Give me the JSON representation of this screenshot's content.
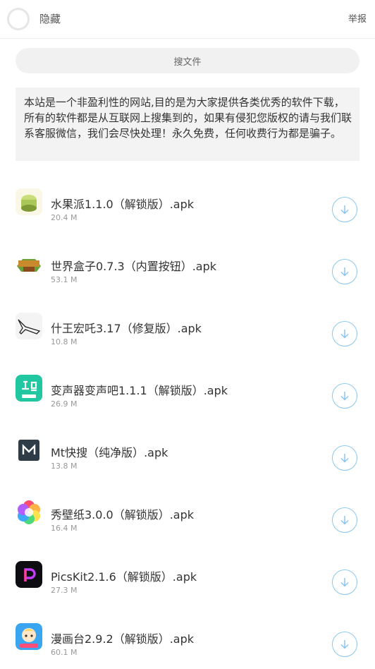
{
  "header": {
    "hide_label": "隐藏",
    "report_label": "举报"
  },
  "search": {
    "placeholder": "搜文件"
  },
  "notice": {
    "text": "本站是一个非盈利性的网站,目的是为大家提供各类优秀的软件下载，所有的软件都是从互联网上搜集到的，如果有侵犯您版权的请与我们联系客服微信，我们会尽快处理！永久免费，任何收费行为都是骗子。"
  },
  "files": [
    {
      "name": "水果派1.1.0（解锁版）.apk",
      "size": "20.4 M",
      "icon": "fruit-pie-app-icon"
    },
    {
      "name": "世界盒子0.7.3（内置按钮）.apk",
      "size": "53.1 M",
      "icon": "worldbox-app-icon"
    },
    {
      "name": "什王宏吒3.17（修复版）.apk",
      "size": "10.8 M",
      "icon": "plane-sketch-app-icon"
    },
    {
      "name": "变声器变声吧1.1.1（解锁版）.apk",
      "size": "26.9 M",
      "icon": "voice-changer-app-icon"
    },
    {
      "name": "Mt快搜（纯净版）.apk",
      "size": "13.8 M",
      "icon": "mt-search-app-icon"
    },
    {
      "name": "秀壁纸3.0.0（解锁版）.apk",
      "size": "16.4 M",
      "icon": "wallpaper-app-icon"
    },
    {
      "name": "PicsKit2.1.6（解锁版）.apk",
      "size": "27.3 M",
      "icon": "picskit-app-icon"
    },
    {
      "name": "漫画台2.9.2（解锁版）.apk",
      "size": "60.1 M",
      "icon": "manhuatai-app-icon"
    }
  ],
  "colors": {
    "download_ring": "#8cc6f0",
    "accent_green": "#21c7a0"
  }
}
